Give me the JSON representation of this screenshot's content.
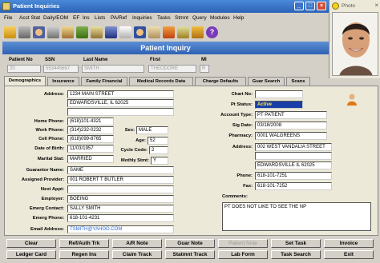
{
  "window": {
    "title": "Patient Inquiries"
  },
  "menu": [
    "File",
    "Acct Stat",
    "Daily/EOM",
    "EF",
    "Ins",
    "Lists",
    "PA/Ref",
    "Inquiries",
    "Tasks",
    "Stmnt",
    "Query",
    "Modules",
    "Help"
  ],
  "photo": {
    "title": "Photo"
  },
  "banner": {
    "title": "Patient Inquiry"
  },
  "top_fields": {
    "patient_no": {
      "label": "Patient No",
      "value": "20"
    },
    "ssn": {
      "label": "SSN",
      "value": "553445667"
    },
    "last_name": {
      "label": "Last Name",
      "value": "SMITH"
    },
    "first": {
      "label": "First",
      "value": "THEODORE"
    },
    "mi": {
      "label": "MI",
      "value": "R"
    }
  },
  "tabs": [
    "Demographics",
    "Insurance",
    "Family Financial",
    "Medical Records Data",
    "Charge Defaults",
    "Guar Search",
    "Scans"
  ],
  "left": {
    "address_label": "Address:",
    "address1": "1234 MAIN STREET",
    "address2": "EDWARDSVILLE, IL 62025",
    "home_phone_label": "Home Phone:",
    "home_phone": "(618)101-4321",
    "work_phone_label": "Work Phone:",
    "work_phone": "(314)232-0232",
    "cell_phone_label": "Cell Phone:",
    "cell_phone": "(618)099-8765",
    "dob_label": "Date of Birth:",
    "dob": "11/03/1957",
    "marital_label": "Marital Stat:",
    "marital": "MARRIED",
    "guarantor_label": "Guarantor Name:",
    "guarantor": "SAME",
    "provider_label": "Assigned Provider:",
    "provider": "001 ROBERT T BUTLER",
    "next_appt_label": "Next Appt:",
    "next_appt": "",
    "employer_label": "Employer:",
    "employer": "BOEING",
    "emerg_contact_label": "Emerg Contact:",
    "emerg_contact": "SALLY SMITH",
    "emerg_phone_label": "Emerg Phone:",
    "emerg_phone": "618-101-4231",
    "email_label": "Email Address:",
    "email": "TSMITH@YAHOO.COM",
    "sex_label": "Sex:",
    "sex": "MALE",
    "age_label": "Age:",
    "age": "52",
    "cycle_label": "Cycle Code:",
    "cycle": "2",
    "mstat_label": "Mothly Stmt:",
    "mstat": "Y"
  },
  "right": {
    "chart_label": "Chart No:",
    "chart": "",
    "status_label": "Pt Status:",
    "status": "Active",
    "account_label": "Account Type:",
    "account": "PT PATIENT",
    "sigdate_label": "Sig Date:",
    "sigdate": "03/18/2008",
    "pharmacy_label": "Pharmacy:",
    "pharmacy": "0001 WALGREENS",
    "ph_address_label": "Address:",
    "ph_address1": "002 WEST VANDALIA STREET",
    "ph_address2": "",
    "ph_address3": "EDWARDSVILLE IL 62025",
    "phone_label": "Phone:",
    "phone": "618-101-7251",
    "fax_label": "Fax:",
    "fax": "618-101-7252",
    "comments_label": "Comments:",
    "comments": "PT DOES NOT LIKE TO SEE THE NP"
  },
  "buttons_row1": [
    "Clear",
    "Ref/Auth Trk",
    "A/R Note",
    "Guar Note",
    "Patient Note",
    "Set Task",
    "Invoice"
  ],
  "buttons_row2": [
    "Ledger Card",
    "Regen Ins",
    "Claim Track",
    "Statmnt Track",
    "Lab Form",
    "Task Search",
    "Exit"
  ],
  "colors": {
    "titlebar": "#2a62b8",
    "banner": "#2e62b4",
    "status_bg": "#1a3ea8",
    "status_fg": "#ffea3a"
  }
}
